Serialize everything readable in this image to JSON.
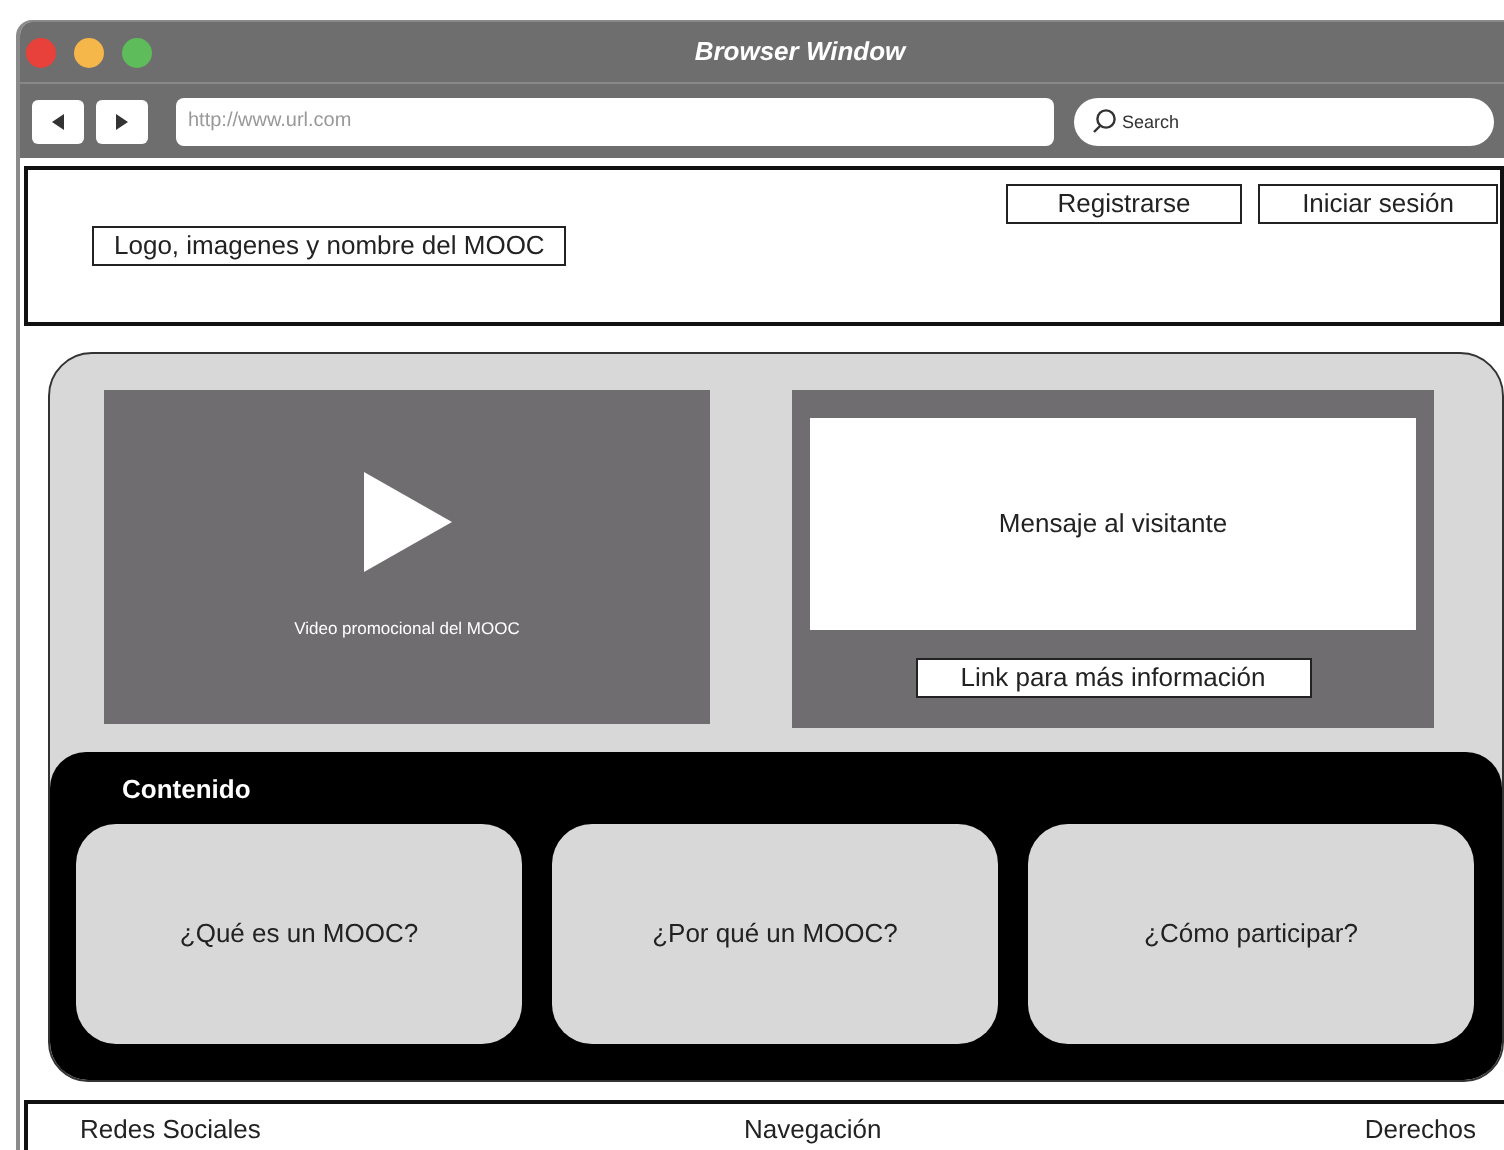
{
  "window": {
    "title": "Browser Window"
  },
  "toolbar": {
    "address": "http://www.url.com",
    "search": {
      "placeholder": "Search"
    }
  },
  "header": {
    "buttons": [
      "Registrarse",
      "Iniciar sesión"
    ],
    "logo": "Logo, imagenes y nombre del MOOC"
  },
  "hero": {
    "video": {
      "caption": "Video promocional del MOOC"
    },
    "message": "Mensaje al visitante",
    "link": "Link para más información"
  },
  "content": {
    "title": "Contenido",
    "cards": [
      "¿Qué es un MOOC?",
      "¿Por qué un MOOC?",
      "¿Cómo participar?"
    ]
  },
  "footer": [
    "Redes Sociales",
    "Navegación",
    "Derechos"
  ]
}
